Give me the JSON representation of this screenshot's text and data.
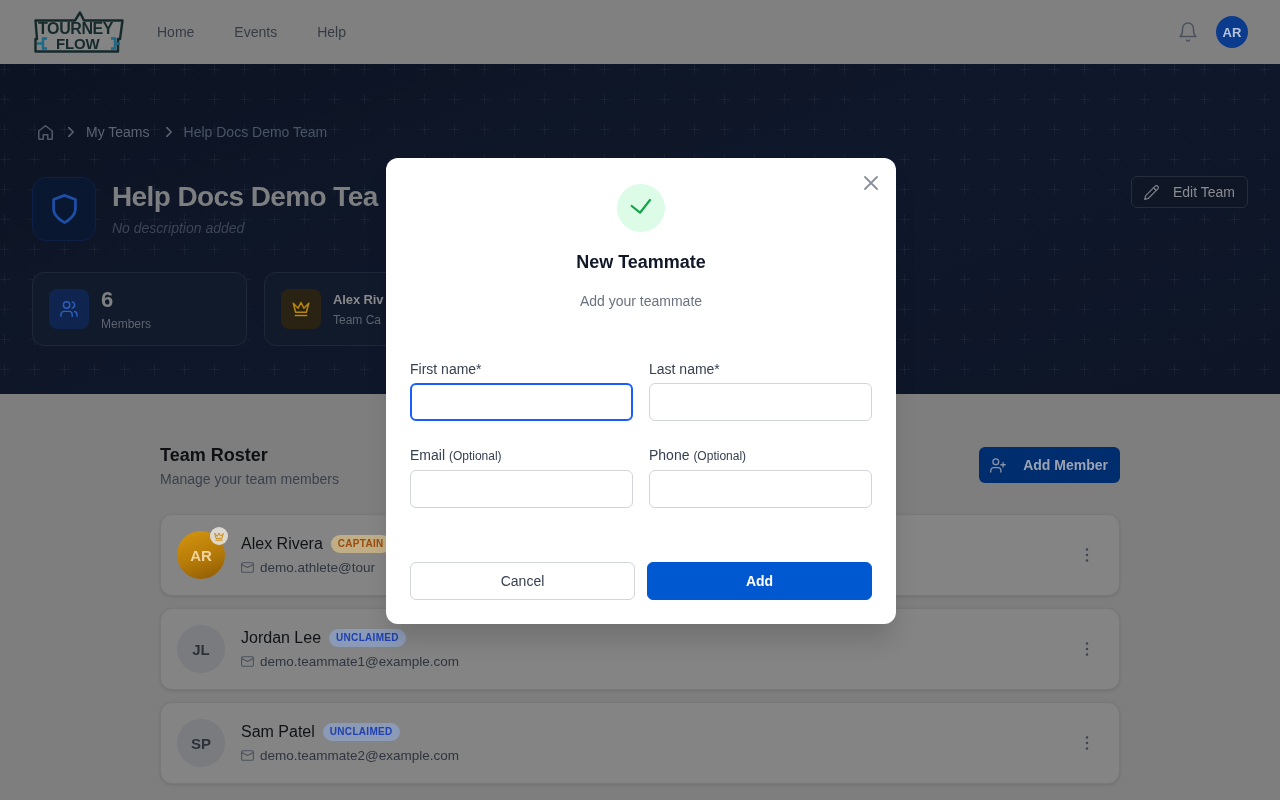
{
  "header": {
    "logo": {
      "line_1": "TOURNEY",
      "line_2": "FLOW"
    },
    "nav": [
      {
        "label": "Home"
      },
      {
        "label": "Events"
      },
      {
        "label": "Help"
      }
    ],
    "user_initials": "AR"
  },
  "breadcrumbs": [
    {
      "label": "My Teams",
      "current": false
    },
    {
      "label": "Help Docs Demo Team",
      "current": true
    }
  ],
  "team": {
    "name": "Help Docs Demo Tea",
    "description": "No description added",
    "edit_button": "Edit Team"
  },
  "stats": [
    {
      "kind": "members",
      "value": "6",
      "label": "Members"
    },
    {
      "kind": "captain",
      "value": "Alex Riv",
      "label": "Team Ca"
    }
  ],
  "roster": {
    "title": "Team Roster",
    "subtitle": "Manage your team members",
    "add_button": "Add Member",
    "members": [
      {
        "kind": "captain",
        "initials": "AR",
        "name": "Alex Rivera",
        "badge": "CAPTAIN",
        "email": "demo.athlete@tour"
      },
      {
        "kind": "unclaimed",
        "initials": "JL",
        "name": "Jordan Lee",
        "badge": "UNCLAIMED",
        "email": "demo.teammate1@example.com"
      },
      {
        "kind": "unclaimed",
        "initials": "SP",
        "name": "Sam Patel",
        "badge": "UNCLAIMED",
        "email": "demo.teammate2@example.com"
      }
    ]
  },
  "modal": {
    "title": "New Teammate",
    "subtitle": "Add your teammate",
    "fields": [
      {
        "label": "First name*",
        "focused": true
      },
      {
        "label": "Last name*",
        "focused": false
      },
      {
        "label": "Email",
        "hint": "(Optional)",
        "focused": false
      },
      {
        "label": "Phone",
        "hint": "(Optional)",
        "focused": false
      }
    ],
    "buttons": [
      {
        "kind": "secondary",
        "label": "Cancel"
      },
      {
        "kind": "primary",
        "label": "Add"
      }
    ]
  }
}
